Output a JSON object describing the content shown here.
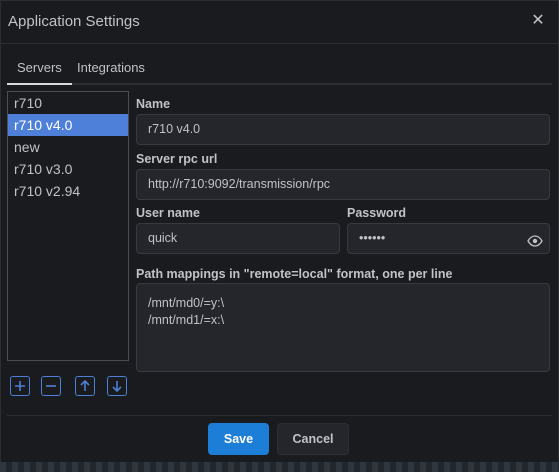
{
  "window": {
    "title": "Application Settings"
  },
  "tabs": [
    {
      "label": "Servers"
    },
    {
      "label": "Integrations"
    }
  ],
  "servers": [
    {
      "name": "r710"
    },
    {
      "name": "r710 v4.0"
    },
    {
      "name": "new"
    },
    {
      "name": "r710 v3.0"
    },
    {
      "name": "r710 v2.94"
    }
  ],
  "list_buttons": [
    "add-icon",
    "remove-icon",
    "move-up-icon",
    "move-down-icon"
  ],
  "form": {
    "name_label": "Name",
    "name_value": "r710 v4.0",
    "url_label": "Server rpc url",
    "url_value": "http://r710:9092/transmission/rpc",
    "user_label": "User name",
    "user_value": "quick",
    "password_label": "Password",
    "password_value": "••••••",
    "mappings_label": "Path mappings in \"remote=local\" format, one per line",
    "mappings": [
      "/mnt/md0/=y:\\",
      "/mnt/md1/=x:\\"
    ]
  },
  "footer": {
    "save_label": "Save",
    "cancel_label": "Cancel"
  },
  "colors": {
    "accent": "#1c7ed6",
    "selected": "#4f80d9",
    "background": "#1a1b1e"
  }
}
